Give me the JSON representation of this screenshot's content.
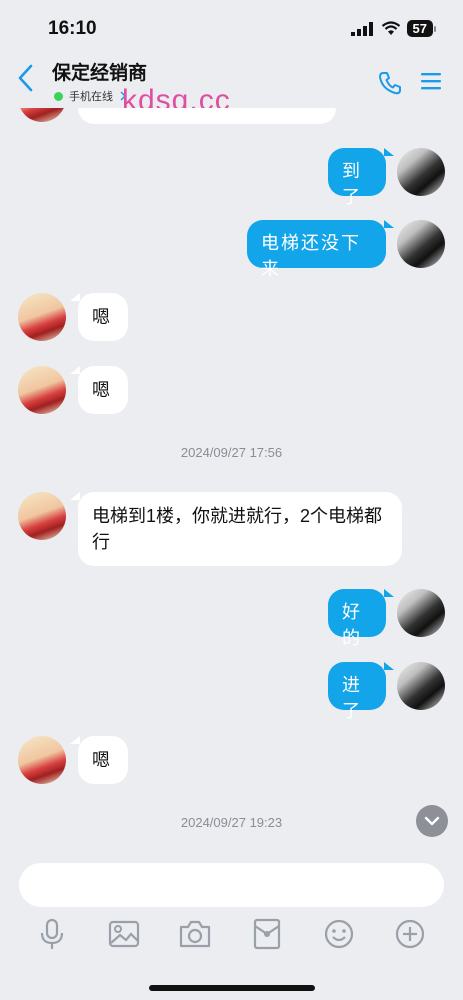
{
  "status_bar": {
    "time": "16:10",
    "battery": "57"
  },
  "header": {
    "title": "保定经销商",
    "status": "手机在线"
  },
  "watermark": "kdsq.cc",
  "messages": {
    "m0": "",
    "m1": "到了",
    "m2": "电梯还没下来",
    "m3": "嗯",
    "m4": "嗯",
    "ts1": "2024/09/27 17:56",
    "m5": "电梯到1楼，你就进就行，2个电梯都行",
    "m6": "好的",
    "m7": "进了",
    "m8": "嗯",
    "ts2": "2024/09/27 19:23"
  },
  "input": {
    "placeholder": ""
  },
  "toolbar": [
    "microphone-icon",
    "image-icon",
    "camera-icon",
    "red-packet-icon",
    "emoji-icon",
    "plus-icon"
  ]
}
